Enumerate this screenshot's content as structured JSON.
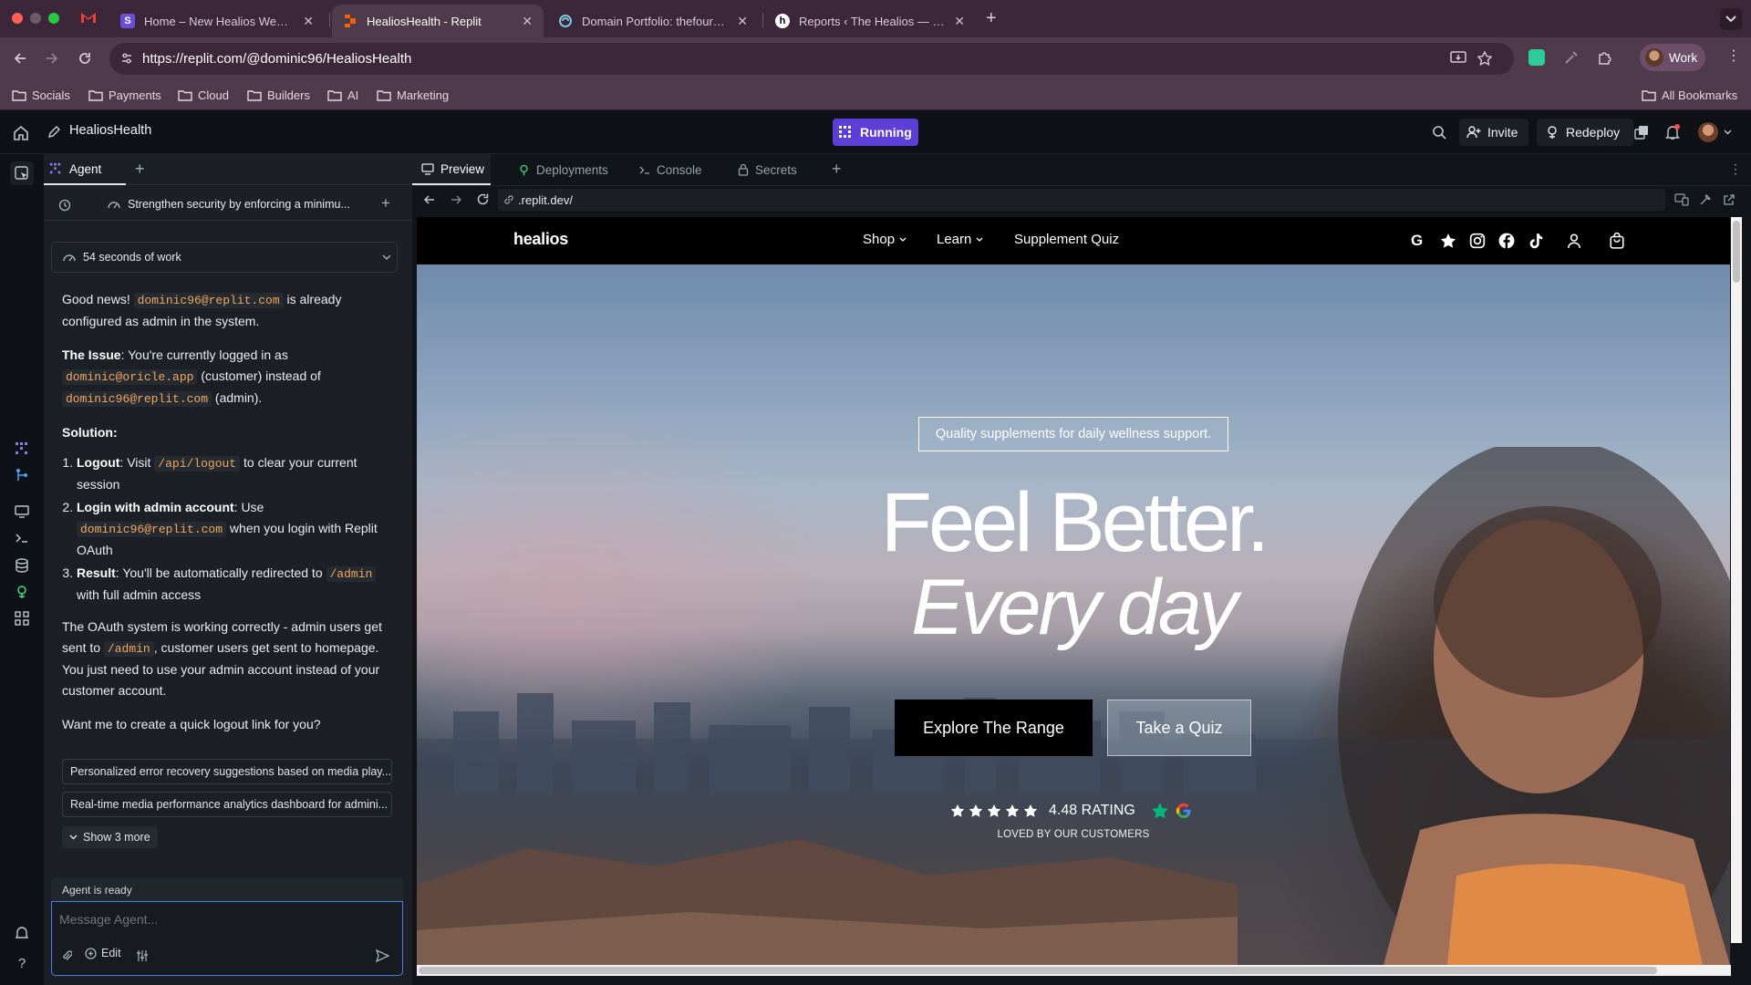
{
  "browser": {
    "tabs": [
      {
        "title": "Home – New Healios Website",
        "favicon": "purple-s-icon"
      },
      {
        "title": "HealiosHealth - Replit",
        "favicon": "replit-icon",
        "active": true
      },
      {
        "title": "Domain Portfolio: thefourths.c",
        "favicon": "portfolio-icon"
      },
      {
        "title": "Reports ‹ The Healios — Wor",
        "favicon": "healios-h-icon"
      }
    ],
    "url": "https://replit.com/@dominic96/HealiosHealth",
    "profile": "Work",
    "bookmarks": [
      "Socials",
      "Payments",
      "Cloud",
      "Builders",
      "AI",
      "Marketing"
    ],
    "all_bookmarks": "All Bookmarks"
  },
  "replit": {
    "project_name": "HealiosHealth",
    "run_status": "Running",
    "invite_label": "Invite",
    "redeploy_label": "Redeploy",
    "accent": "#5b3fd6"
  },
  "agent": {
    "tab_label": "Agent",
    "checkpoint": "Strengthen security by enforcing a minimu...",
    "work_summary": "54 seconds of work",
    "intro_1": "Good news!",
    "email_admin": "dominic96@replit.com",
    "intro_2": "is already configured as admin in the system.",
    "issue_label": "The Issue",
    "issue_1": ": You're currently logged in as",
    "email_customer": "dominic@oricle.app",
    "issue_2": "(customer) instead of",
    "issue_3": "(admin).",
    "solution_label": "Solution:",
    "step1_label": "Logout",
    "step1_1": ": Visit",
    "step1_code": "/api/logout",
    "step1_2": "to clear your current session",
    "step2_label": "Login with admin account",
    "step2_1": ": Use",
    "step2_2": "when you login with Replit OAuth",
    "step3_label": "Result",
    "step3_1": ": You'll be automatically redirected to",
    "step3_code": "/admin",
    "step3_2": "with full admin access",
    "para_1": "The OAuth system is working correctly - admin users get sent to",
    "para_code": "/admin",
    "para_2": ", customer users get sent to homepage. You just need to use your admin account instead of your customer account.",
    "question": "Want me to create a quick logout link for you?",
    "suggestions": [
      "Personalized error recovery suggestions based on media play...",
      "Real-time media performance analytics dashboard for admini..."
    ],
    "show_more": "Show 3 more",
    "status": "Agent is ready",
    "input_placeholder": "Message Agent...",
    "edit_label": "Edit"
  },
  "workspace_tabs": [
    "Preview",
    "Deployments",
    "Console",
    "Secrets"
  ],
  "preview_url": ".replit.dev/",
  "site": {
    "logo": "healios",
    "nav": [
      "Shop",
      "Learn",
      "Supplement Quiz"
    ],
    "badge": "Quality supplements for daily wellness support.",
    "headline_1": "Feel Better.",
    "headline_2": "Every day",
    "cta_primary": "Explore The Range",
    "cta_secondary": "Take a Quiz",
    "rating": "4.48 RATING",
    "rating_stars": 5,
    "rating_sub": "LOVED BY OUR CUSTOMERS"
  }
}
